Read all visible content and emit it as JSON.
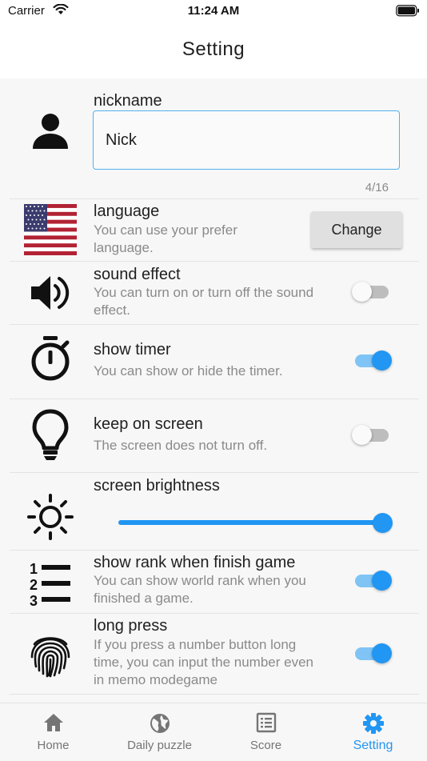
{
  "status_bar": {
    "carrier": "Carrier",
    "time": "11:24 AM"
  },
  "header": {
    "title": "Setting"
  },
  "nickname": {
    "label": "nickname",
    "value": "Nick",
    "counter": "4/16"
  },
  "language": {
    "title": "language",
    "description": "You can use your prefer language.",
    "button_label": "Change"
  },
  "sound_effect": {
    "title": "sound effect",
    "description": "You can turn on or turn off the sound effect.",
    "enabled": false
  },
  "show_timer": {
    "title": "show timer",
    "description": "You can show or hide the timer.",
    "enabled": true
  },
  "keep_on_screen": {
    "title": "keep on screen",
    "description": "The screen does not turn off.",
    "enabled": false
  },
  "screen_brightness": {
    "title": "screen brightness",
    "value": 1.0
  },
  "show_rank": {
    "title": "show rank when finish game",
    "description": "You can show world rank when you finished a game.",
    "enabled": true
  },
  "long_press": {
    "title": "long press",
    "description": "If you press a number button long time, you can input the number even in memo modegame",
    "enabled": true
  },
  "tabs": [
    {
      "label": "Home",
      "icon": "home-icon",
      "active": false
    },
    {
      "label": "Daily puzzle",
      "icon": "globe-icon",
      "active": false
    },
    {
      "label": "Score",
      "icon": "list-icon",
      "active": false
    },
    {
      "label": "Setting",
      "icon": "gear-icon",
      "active": true
    }
  ],
  "colors": {
    "accent": "#2196f3",
    "accent_light": "#7fc4f5",
    "input_border": "#53b0f0",
    "muted_text": "#8a8a8a"
  }
}
